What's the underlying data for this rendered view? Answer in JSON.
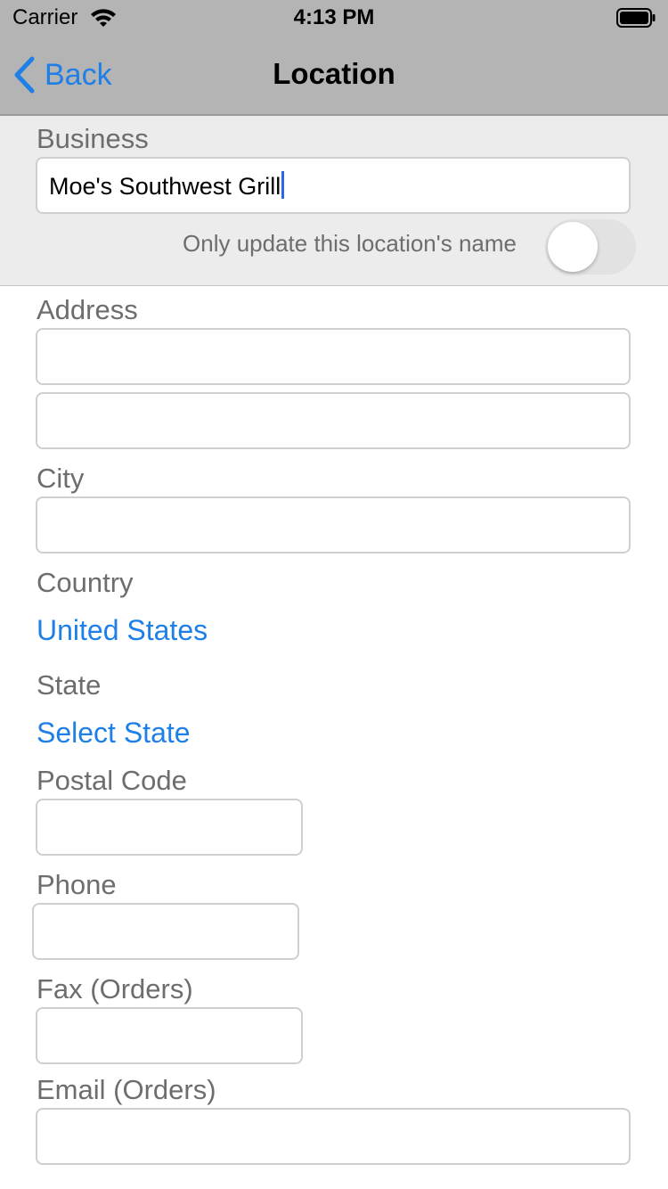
{
  "status_bar": {
    "carrier": "Carrier",
    "time": "4:13 PM"
  },
  "nav": {
    "back_label": "Back",
    "title": "Location"
  },
  "business": {
    "label": "Business",
    "value": "Moe's Southwest Grill",
    "toggle_label": "Only update this location's name",
    "toggle_on": false
  },
  "form": {
    "address_label": "Address",
    "address_line1": "",
    "address_line2": "",
    "city_label": "City",
    "city_value": "",
    "country_label": "Country",
    "country_value": "United States",
    "state_label": "State",
    "state_value": "Select State",
    "postal_label": "Postal Code",
    "postal_value": "",
    "phone_label": "Phone",
    "phone_value": "",
    "fax_label": "Fax (Orders)",
    "fax_value": "",
    "email_label": "Email (Orders)",
    "email_value": ""
  },
  "colors": {
    "accent": "#1e7fe6",
    "bar_bg": "#b4b4b4",
    "section_bg": "#ececec",
    "caret": "#2f65e8"
  },
  "icons": {
    "back": "chevron-left-icon",
    "wifi": "wifi-icon",
    "battery": "battery-icon"
  }
}
